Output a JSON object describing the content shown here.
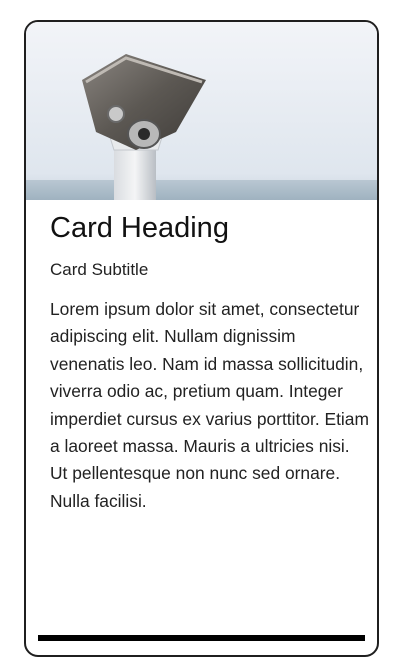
{
  "card": {
    "image_alt": "coin operated binoculars viewer",
    "heading": "Card Heading",
    "subtitle": "Card Subtitle",
    "body": "Lorem ipsum dolor sit amet, consectetur adipiscing elit. Nullam dignissim venenatis leo. Nam id massa sollicitudin, viverra odio ac, pretium quam. Integer imperdiet cursus ex varius porttitor. Etiam a laoreet massa. Mauris a ultricies nisi. Ut pellentesque non nunc sed ornare. Nulla facilisi."
  }
}
